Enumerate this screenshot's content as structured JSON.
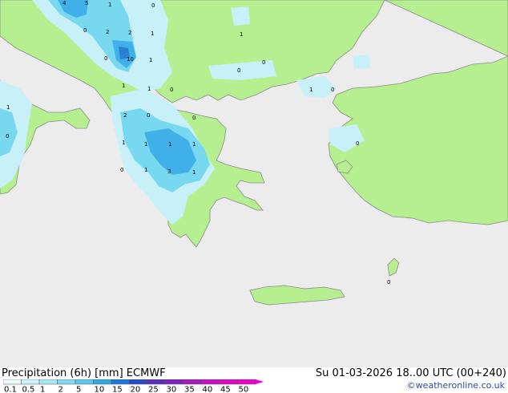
{
  "map": {
    "value_labels": [
      "4",
      "5",
      "1",
      "0",
      "2",
      "2",
      "1",
      "0",
      "10",
      "0",
      "1",
      "1",
      "0",
      "1",
      "1",
      "0",
      "1",
      "0",
      "2",
      "0",
      "0",
      "1",
      "0",
      "1",
      "1",
      "1",
      "3",
      "1",
      "0",
      "1",
      "1",
      "0",
      "0",
      "0"
    ],
    "colors": {
      "land": "#b6ef8f",
      "sea": "#ececec",
      "precip_light": "#c8f0f8",
      "precip_mid": "#78d8f0",
      "precip_strong": "#40b0e8",
      "precip_heavy": "#2a80d0"
    }
  },
  "footer": {
    "title": "Precipitation (6h) [mm] ECMWF",
    "timestamp": "Su 01-03-2026 18..00 UTC (00+240)",
    "credit": "©weatheronline.co.uk"
  },
  "legend": {
    "labels": [
      "0.1",
      "0.5",
      "1",
      "2",
      "5",
      "10",
      "15",
      "20",
      "25",
      "30",
      "35",
      "40",
      "45",
      "50"
    ],
    "colors": [
      "#eefcff",
      "#cff3fb",
      "#a8e8f6",
      "#80daf2",
      "#58c8ee",
      "#30a8e6",
      "#1a78d8",
      "#2a4ac8",
      "#5a30c0",
      "#8020c0",
      "#a818c0",
      "#c810c8",
      "#e008c8",
      "#f000d0"
    ]
  }
}
